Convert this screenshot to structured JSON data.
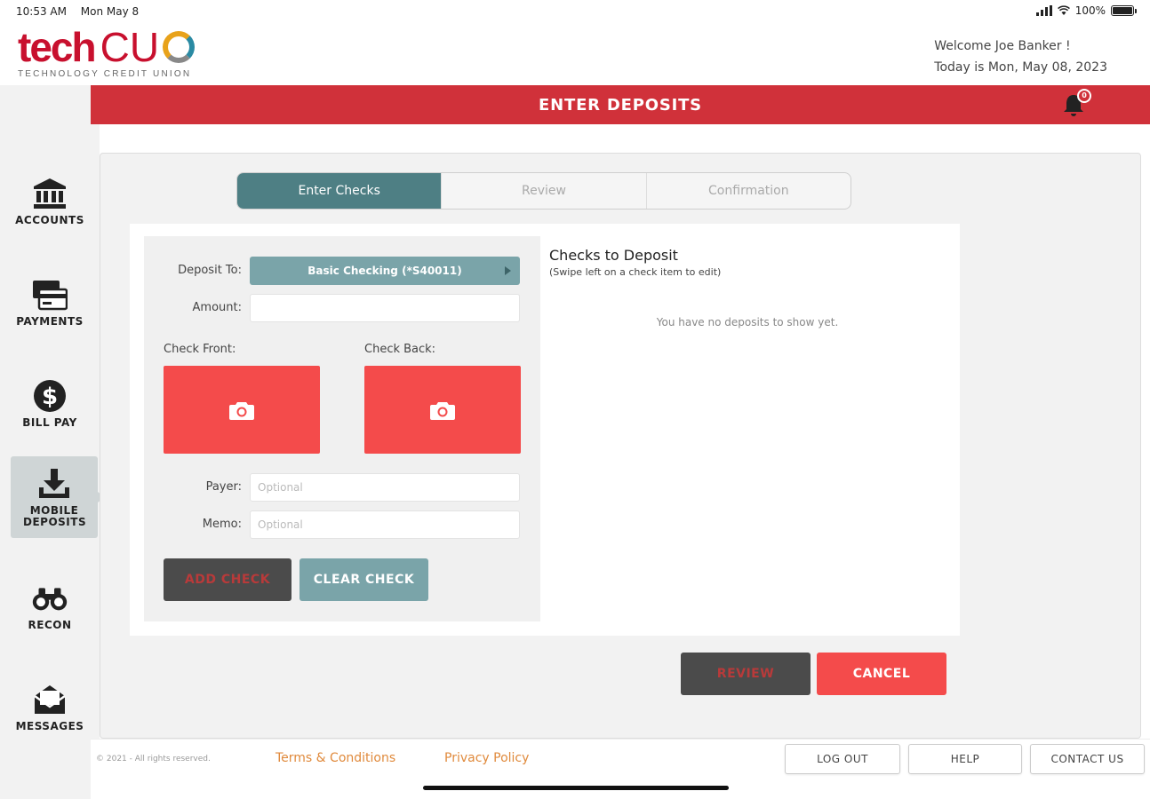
{
  "status_bar": {
    "time": "10:53 AM",
    "date": "Mon May 8",
    "battery": "100%"
  },
  "header": {
    "logo_tech": "tech",
    "logo_cu": "CU",
    "logo_sub": "TECHNOLOGY CREDIT UNION",
    "welcome": "Welcome Joe Banker !",
    "today": "Today is Mon, May 08, 2023"
  },
  "sidebar": {
    "items": [
      {
        "label": "ACCOUNTS"
      },
      {
        "label": "PAYMENTS"
      },
      {
        "label": "BILL PAY"
      },
      {
        "label": "MOBILE DEPOSITS"
      },
      {
        "label": "RECON"
      },
      {
        "label": "MESSAGES"
      }
    ]
  },
  "title_bar": {
    "title": "ENTER DEPOSITS",
    "notification_count": "0"
  },
  "stepper": {
    "steps": [
      "Enter Checks",
      "Review",
      "Confirmation"
    ]
  },
  "form": {
    "deposit_to_label": "Deposit To:",
    "deposit_to_value": "Basic Checking (*S40011)",
    "amount_label": "Amount:",
    "check_front_label": "Check Front:",
    "check_back_label": "Check Back:",
    "payer_label": "Payer:",
    "payer_placeholder": "Optional",
    "memo_label": "Memo:",
    "memo_placeholder": "Optional",
    "add_check": "ADD CHECK",
    "clear_check": "CLEAR CHECK"
  },
  "checks": {
    "title": "Checks to Deposit",
    "subtitle": "(Swipe left on a check item to edit)",
    "empty": "You have no deposits to show yet."
  },
  "actions": {
    "review": "REVIEW",
    "cancel": "CANCEL"
  },
  "footer": {
    "copyright": "© 2021 - All rights reserved.",
    "terms": "Terms & Conditions",
    "privacy": "Privacy Policy",
    "logout": "LOG OUT",
    "help": "HELP",
    "contact": "CONTACT US"
  },
  "colors": {
    "brand_red": "#d0313a",
    "teal": "#4e7f84",
    "camera_red": "#f44b4b",
    "link_orange": "#e08a3c"
  }
}
